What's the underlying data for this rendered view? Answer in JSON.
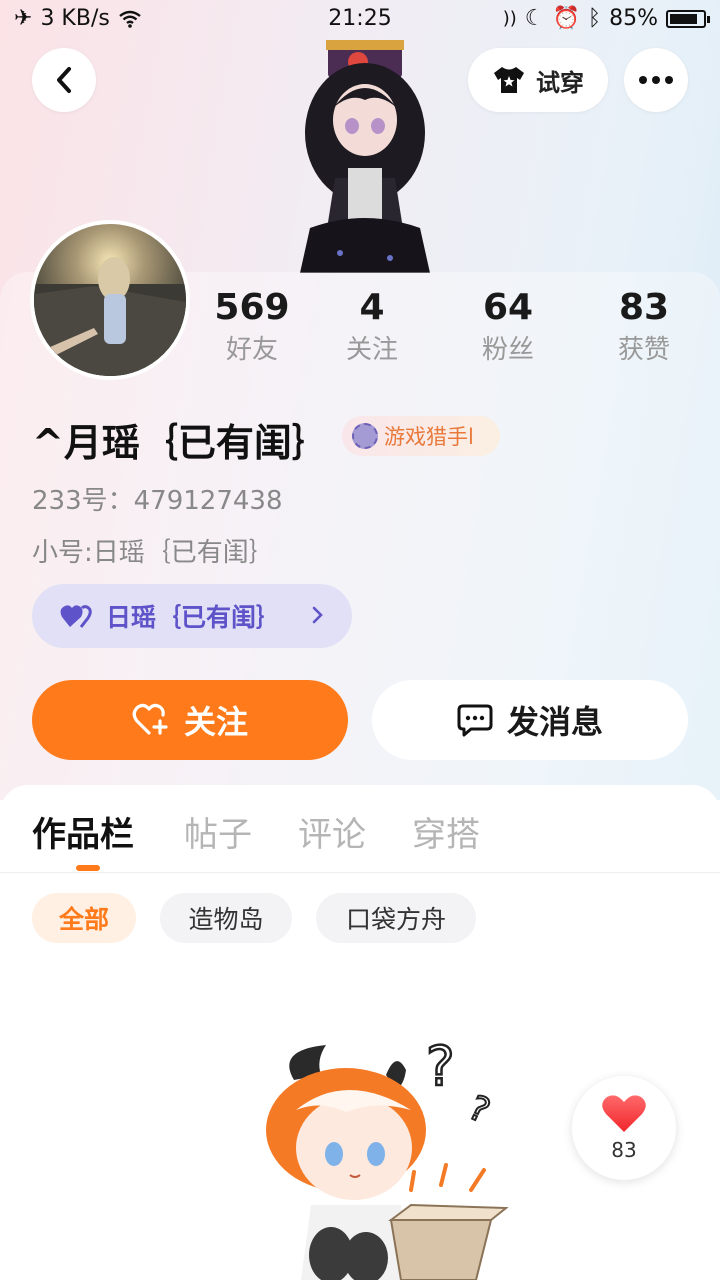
{
  "status_bar": {
    "network_speed": "3 KB/s",
    "time": "21:25",
    "battery": "85%",
    "battery_level": 0.85
  },
  "top_bar": {
    "tryon_label": "试穿"
  },
  "stats": [
    {
      "value": "569",
      "label": "好友"
    },
    {
      "value": "4",
      "label": "关注"
    },
    {
      "value": "64",
      "label": "粉丝"
    },
    {
      "value": "83",
      "label": "获赞"
    }
  ],
  "profile": {
    "username": "^月瑶｛已有闺｝",
    "badge": "游戏猎手l",
    "uid": "233号：479127438",
    "alt_account": "小号:日瑶｛已有闺｝",
    "alt_pill_label": "日瑶｛已有闺｝"
  },
  "actions": {
    "follow": "关注",
    "message": "发消息"
  },
  "tabs": [
    "作品栏",
    "帖子",
    "评论",
    "穿搭"
  ],
  "filters": [
    "全部",
    "造物岛",
    "口袋方舟"
  ],
  "like_fab": {
    "count": "83"
  },
  "colors": {
    "accent": "#ff7a1a",
    "alt_pill_text": "#5e53c9",
    "badge_text": "#e8793b"
  }
}
